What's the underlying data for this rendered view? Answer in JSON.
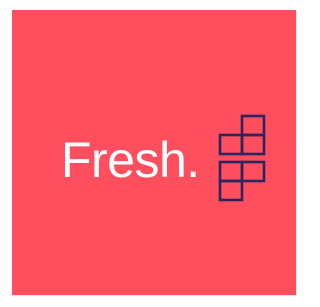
{
  "logo": {
    "wordmark": "Fresh.",
    "icon_name": "stacked-squares-icon"
  },
  "colors": {
    "background": "#ff4f5e",
    "wordmark": "#ffffff",
    "icon": "#2a2660",
    "page": "#ffffff"
  }
}
